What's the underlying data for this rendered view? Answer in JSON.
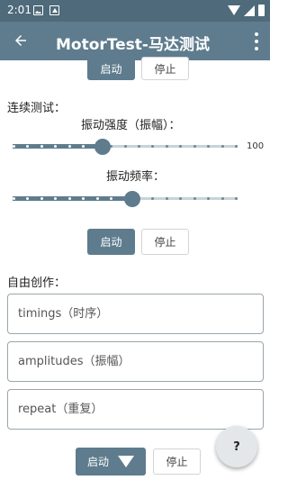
{
  "status_bar": {
    "time": "2:01"
  },
  "app_bar": {
    "title": "MotorTest-马达测试"
  },
  "top_section": {
    "start_label": "启动",
    "stop_label": "停止"
  },
  "continuous": {
    "heading": "连续测试：",
    "strength_label": "振动强度（振幅）：",
    "strength_value_text": "100",
    "strength_level": 0.4,
    "frequency_label": "振动频率：",
    "frequency_level": 0.53,
    "start_label": "启动",
    "stop_label": "停止"
  },
  "free_create": {
    "heading": "自由创作：",
    "timings_placeholder": "timings（时序）",
    "amplitudes_placeholder": "amplitudes（振幅）",
    "repeat_placeholder": "repeat（重复）",
    "start_label": "启动",
    "stop_label": "停止"
  },
  "fab": {
    "label": "?"
  },
  "icons": [
    "back-arrow-icon",
    "more-vert-icon",
    "wifi-icon",
    "signal-icon",
    "battery-icon",
    "play-triangle-icon"
  ],
  "colors": {
    "primary": "#5e7c8d",
    "status": "#4f6a7a"
  }
}
